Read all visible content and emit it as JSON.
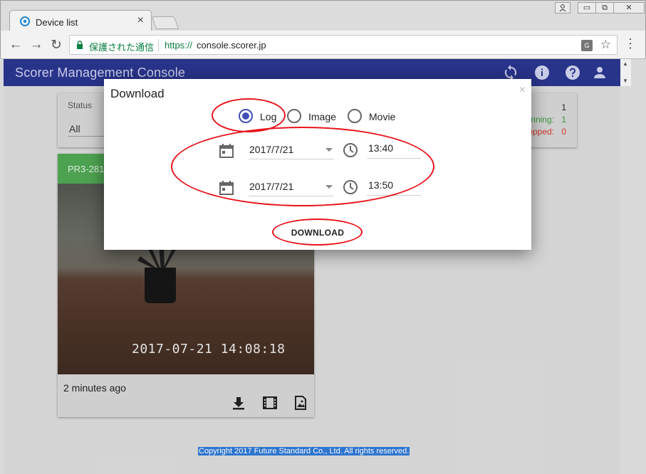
{
  "browser": {
    "tab_title": "Device list",
    "tab_close": "×",
    "secure_label": "保護された通信",
    "url_scheme": "https://",
    "url_host": "console.scorer.jp",
    "window_controls": {
      "minimize": "▭",
      "maximize": "⧉",
      "close": "✕"
    },
    "nav": {
      "back": "←",
      "forward": "→",
      "reload": "↻"
    },
    "translate_glyph": "G",
    "bookmark_glyph": "☆",
    "menu_glyph": "⋮"
  },
  "app": {
    "title": "Scorer Management Console",
    "header_icons": [
      "sync-icon",
      "info-icon",
      "help-icon",
      "account-icon"
    ],
    "accent_color": "#28338a"
  },
  "filter": {
    "status_label": "Status",
    "status_value": "All",
    "stats": [
      {
        "label": "t:",
        "value": "1",
        "color": "#222222"
      },
      {
        "label": "nning:",
        "value": "1",
        "color": "#3a9a3e"
      },
      {
        "label": "opped:",
        "value": "0",
        "color": "#d23a2a"
      }
    ]
  },
  "device": {
    "name": "PR3-281",
    "camera_timestamp": "2017-07-21  14:08:18",
    "last_seen": "2 minutes ago",
    "status_color": "#4fa653",
    "actions": [
      "download-icon",
      "movie-icon",
      "image-icon"
    ]
  },
  "footer": {
    "copyright": "Copyright 2017 Future Standard Co., Ltd. All rights reserved."
  },
  "download_dialog": {
    "title": "Download",
    "close_glyph": "×",
    "types": [
      {
        "label": "Log",
        "checked": true
      },
      {
        "label": "Image",
        "checked": false
      },
      {
        "label": "Movie",
        "checked": false
      }
    ],
    "start": {
      "date": "2017/7/21",
      "time": "13:40"
    },
    "end": {
      "date": "2017/7/21",
      "time": "13:50"
    },
    "download_label": "DOWNLOAD"
  }
}
